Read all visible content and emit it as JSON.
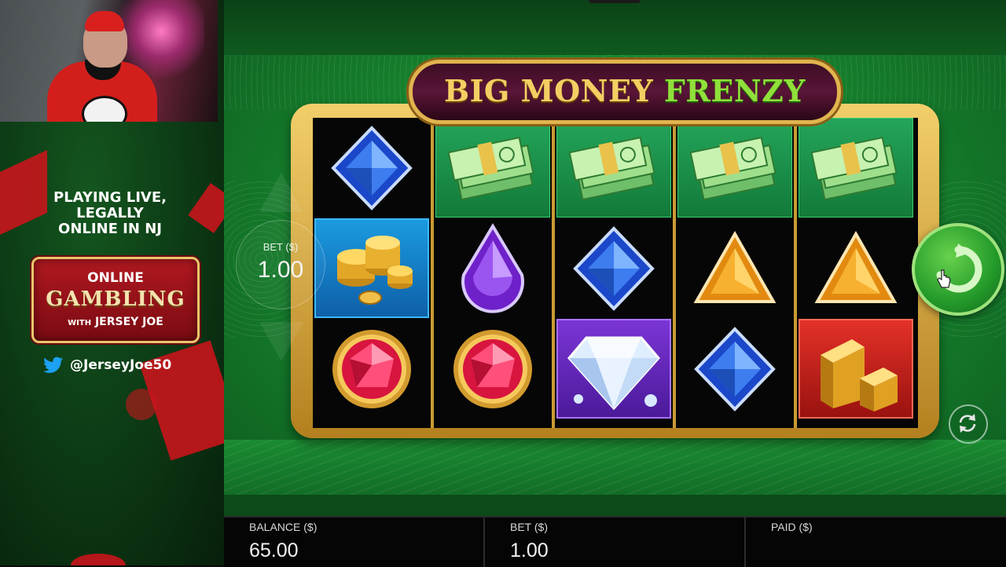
{
  "stream_overlay": {
    "tagline": [
      "PLAYING LIVE,",
      "LEGALLY",
      "ONLINE IN NJ"
    ],
    "logo": {
      "line1": "ONLINE",
      "line2": "GAMBLING",
      "line3_small": "WITH",
      "line3": "JERSEY JOE"
    },
    "twitter_handle": "@JerseyJoe50",
    "accent_color": "#c8151c"
  },
  "game": {
    "title_part1": "BIG MONEY",
    "title_part2": "FRENZY",
    "reels": [
      [
        "blue-diamond",
        "gold-coins",
        "pink-gem"
      ],
      [
        "money-stack",
        "purple-drop",
        "pink-gem"
      ],
      [
        "money-stack",
        "blue-diamond",
        "big-white-diamond"
      ],
      [
        "money-stack",
        "orange-triangle",
        "blue-diamond"
      ],
      [
        "money-stack",
        "orange-triangle",
        "gold-bars"
      ]
    ],
    "bet_widget": {
      "label": "BET ($)",
      "value": "1.00"
    },
    "spin_icon": "spin-arrow-icon",
    "autoplay_icon": "autoplay-icon"
  },
  "info_bar": {
    "balance_label": "BALANCE ($)",
    "balance_value": "65.00",
    "bet_label": "BET ($)",
    "bet_value": "1.00",
    "paid_label": "PAID ($)",
    "paid_value": ""
  }
}
